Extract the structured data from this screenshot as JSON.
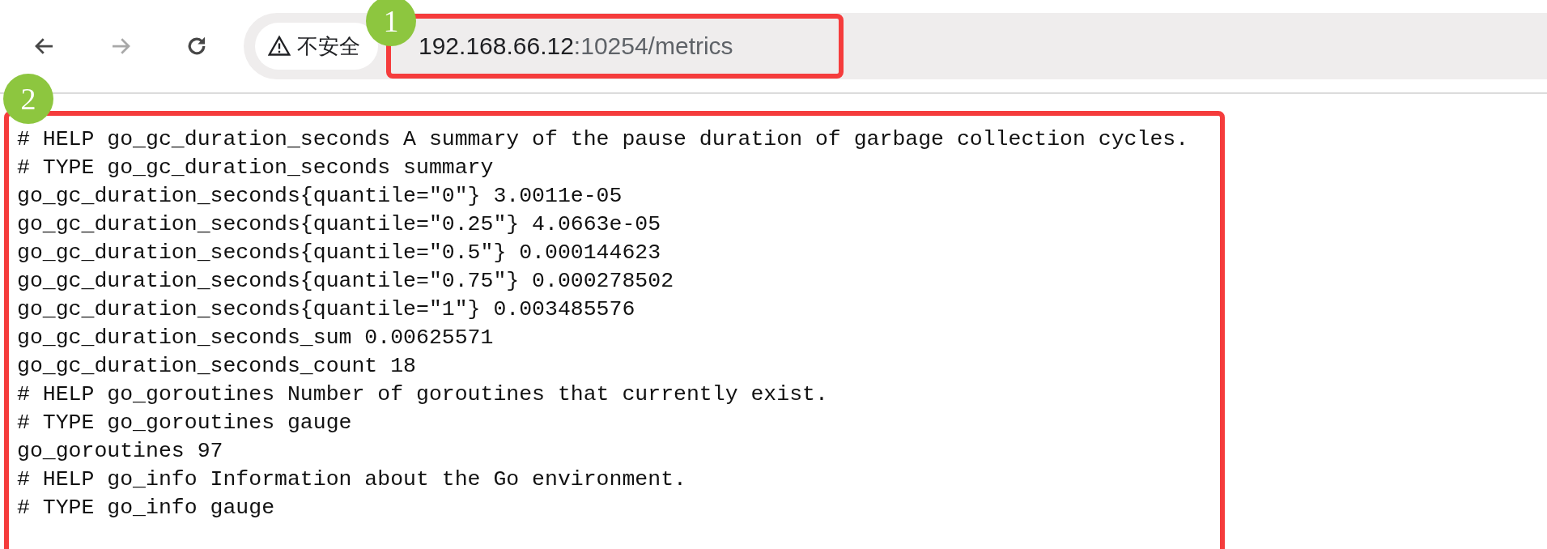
{
  "toolbar": {
    "nav_buttons": [
      {
        "kind": "back",
        "disabled": false
      },
      {
        "kind": "forward",
        "disabled": true
      },
      {
        "kind": "reload",
        "disabled": false
      }
    ],
    "address_bar": {
      "security_label": "不安全",
      "url_host": "192.168.66.12",
      "url_rest": ":10254/metrics"
    }
  },
  "annotations": [
    {
      "label": "1"
    },
    {
      "label": "2"
    }
  ],
  "page_lines": [
    "# HELP go_gc_duration_seconds A summary of the pause duration of garbage collection cycles.",
    "# TYPE go_gc_duration_seconds summary",
    "go_gc_duration_seconds{quantile=\"0\"} 3.0011e-05",
    "go_gc_duration_seconds{quantile=\"0.25\"} 4.0663e-05",
    "go_gc_duration_seconds{quantile=\"0.5\"} 0.000144623",
    "go_gc_duration_seconds{quantile=\"0.75\"} 0.000278502",
    "go_gc_duration_seconds{quantile=\"1\"} 0.003485576",
    "go_gc_duration_seconds_sum 0.00625571",
    "go_gc_duration_seconds_count 18",
    "# HELP go_goroutines Number of goroutines that currently exist.",
    "# TYPE go_goroutines gauge",
    "go_goroutines 97",
    "# HELP go_info Information about the Go environment.",
    "# TYPE go_info gauge"
  ]
}
